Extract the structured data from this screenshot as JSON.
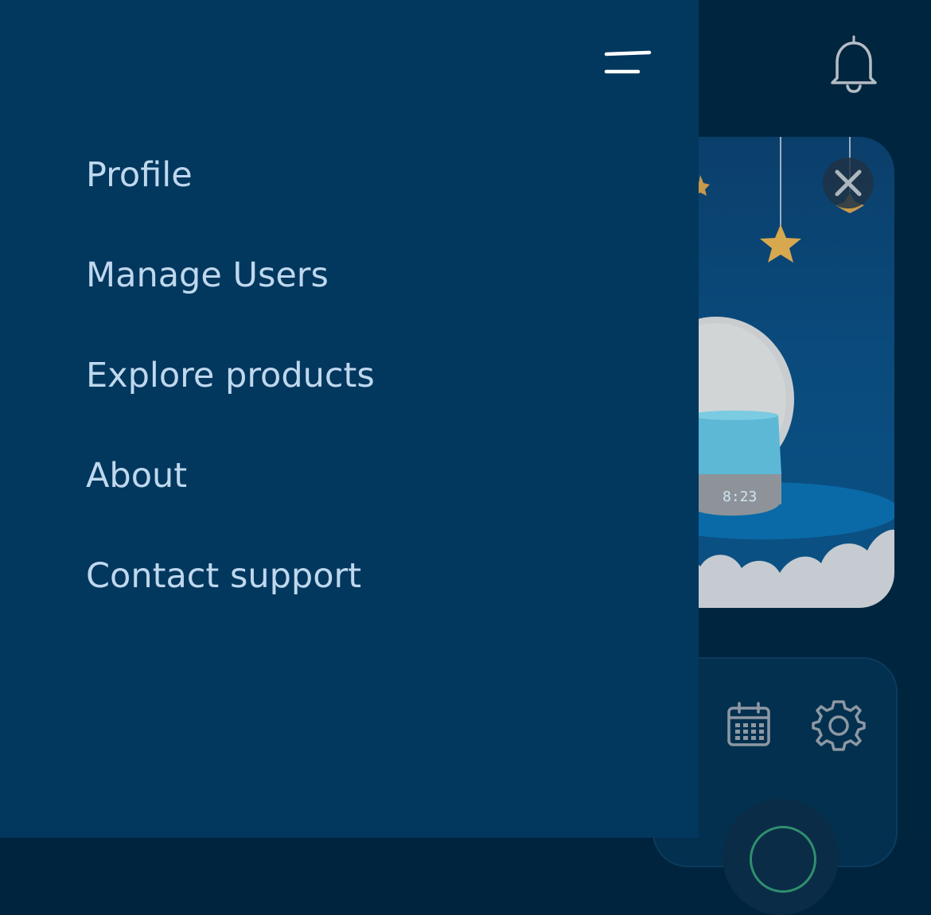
{
  "drawer": {
    "toggle_icon": "menu-close-icon",
    "items": [
      {
        "label": "Profile"
      },
      {
        "label": "Manage Users"
      },
      {
        "label": "Explore products"
      },
      {
        "label": "About"
      },
      {
        "label": "Contact support"
      }
    ]
  },
  "background": {
    "header_icon": "bell-icon",
    "promo": {
      "device_clock": "8:23",
      "close_icon": "close-icon"
    },
    "controls": {
      "icons": [
        "calendar-icon",
        "gear-icon"
      ]
    }
  },
  "colors": {
    "drawer_bg": "#02375e",
    "menu_text": "#bfd8ee",
    "backdrop": "#00253f"
  }
}
